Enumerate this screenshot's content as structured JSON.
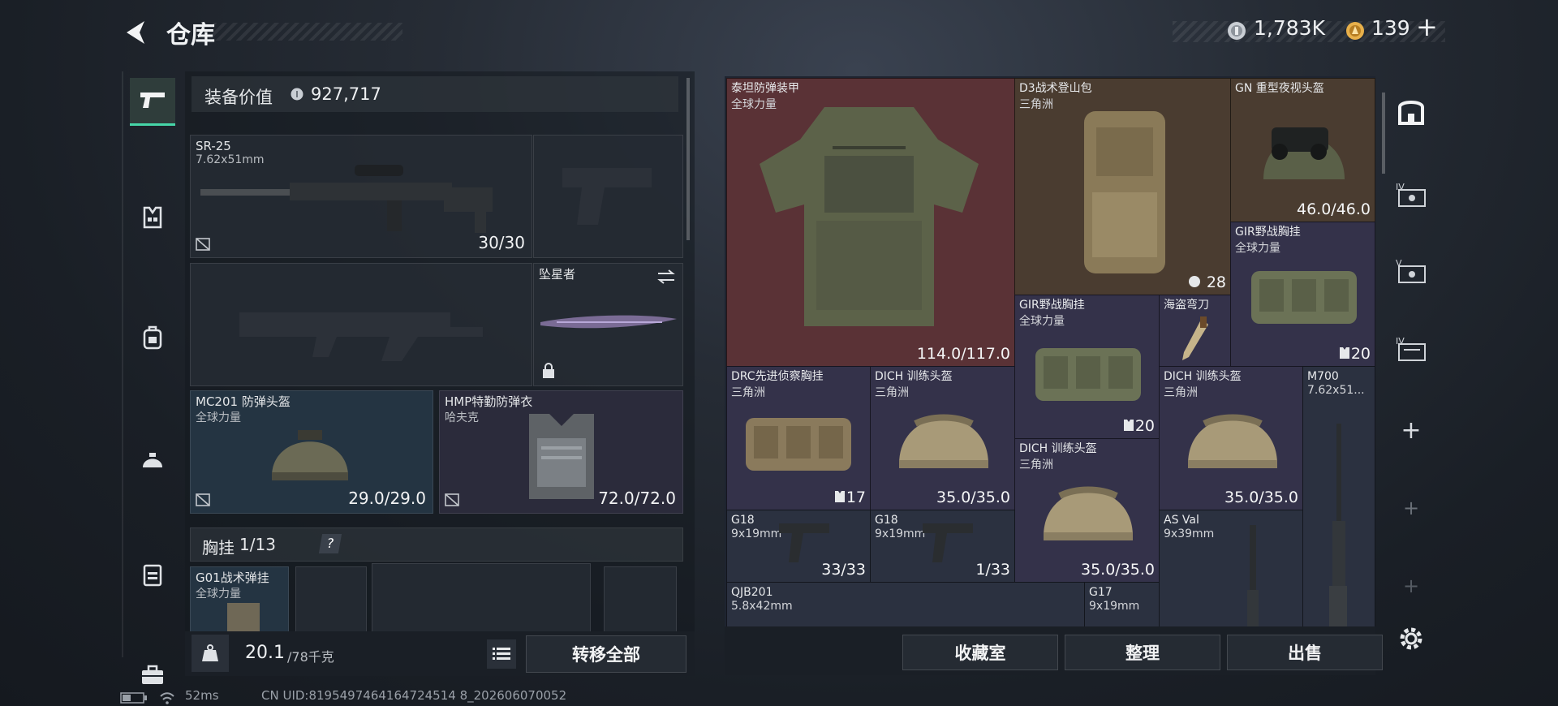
{
  "header": {
    "title": "仓库",
    "silver": "1,783K",
    "gold": "139",
    "plus": "+"
  },
  "left": {
    "equip_label": "装备价值",
    "equip_value": "927,717",
    "primary": {
      "name": "SR-25",
      "caliber": "7.62x51mm",
      "ammo": "30/30"
    },
    "melee": {
      "name": "坠星者"
    },
    "helmet": {
      "name": "MC201 防弹头盔",
      "sub": "全球力量",
      "dur": "29.0/29.0"
    },
    "armor": {
      "name": "HMP特勤防弹衣",
      "sub": "哈夫克",
      "dur": "72.0/72.0"
    },
    "rig_label": "胸挂",
    "rig_count": "1/13",
    "rig_help": "?",
    "rig_item": {
      "name": "G01战术弹挂",
      "sub": "全球力量"
    },
    "weight": "20.1",
    "weight_max": "/78千克",
    "transfer_all": "转移全部"
  },
  "stash": {
    "items": [
      {
        "name": "泰坦防弹装甲",
        "sub": "全球力量",
        "val": "114.0/117.0"
      },
      {
        "name": "D3战术登山包",
        "sub": "三角洲",
        "val": "28"
      },
      {
        "name": "GN 重型夜视头盔",
        "sub": "",
        "val": "46.0/46.0"
      },
      {
        "name": "GIR野战胸挂",
        "sub": "全球力量",
        "val": "20"
      },
      {
        "name": "GIR野战胸挂",
        "sub": "全球力量",
        "val": "20"
      },
      {
        "name": "海盗弯刀",
        "sub": "",
        "val": ""
      },
      {
        "name": "DRC先进侦察胸挂",
        "sub": "三角洲",
        "val": "17"
      },
      {
        "name": "DICH 训练头盔",
        "sub": "三角洲",
        "val": "35.0/35.0"
      },
      {
        "name": "DICH 训练头盔",
        "sub": "三角洲",
        "val": "35.0/35.0"
      },
      {
        "name": "DICH 训练头盔",
        "sub": "三角洲",
        "val": "35.0/35.0"
      },
      {
        "name": "M700",
        "sub": "7.62x51...",
        "val": ""
      },
      {
        "name": "G18",
        "sub": "9x19mm",
        "val": "33/33"
      },
      {
        "name": "G18",
        "sub": "9x19mm",
        "val": "1/33"
      },
      {
        "name": "AS Val",
        "sub": "9x39mm",
        "val": ""
      },
      {
        "name": "QJB201",
        "sub": "5.8x42mm",
        "val": ""
      },
      {
        "name": "G17",
        "sub": "9x19mm",
        "val": ""
      }
    ],
    "btn_collect": "收藏室",
    "btn_sort": "整理",
    "btn_sell": "出售"
  },
  "status": {
    "ping": "52ms",
    "uid": "CN UID:8195497464164724514 8_202606070052"
  },
  "colors": {
    "accent": "#46d6a8",
    "red_rarity": "#5a3236",
    "purple_rarity": "#34324a"
  }
}
